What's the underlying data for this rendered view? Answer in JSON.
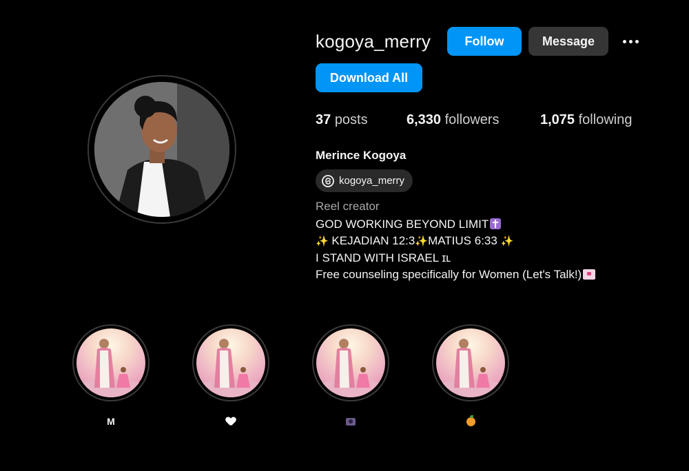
{
  "profile": {
    "username": "kogoya_merry",
    "follow_label": "Follow",
    "message_label": "Message",
    "download_all_label": "Download All",
    "posts_count": "37",
    "posts_label": "posts",
    "followers_count": "6,330",
    "followers_label": "followers",
    "following_count": "1,075",
    "following_label": "following",
    "full_name": "Merince Kogoya",
    "threads_handle": "kogoya_merry",
    "category": "Reel creator",
    "bio": {
      "line1": "GOD WORKING BEYOND LIMIT",
      "line2_a": "KEJADIAN 12:3",
      "line2_b": "MATIUS 6:33",
      "line3": "I STAND WITH ISRAEL ɪʟ",
      "line4": "Free counseling specifically for Women (Let's Talk!)"
    }
  },
  "highlights": [
    {
      "label": "M",
      "icon": "letter"
    },
    {
      "label": "",
      "icon": "white-heart-icon"
    },
    {
      "label": "",
      "icon": "movie-camera-icon"
    },
    {
      "label": "",
      "icon": "tangerine-icon"
    }
  ],
  "colors": {
    "background": "#000000",
    "primary_button": "#0095f6",
    "secondary_button": "#363636",
    "muted_text": "#a8a8a8"
  }
}
